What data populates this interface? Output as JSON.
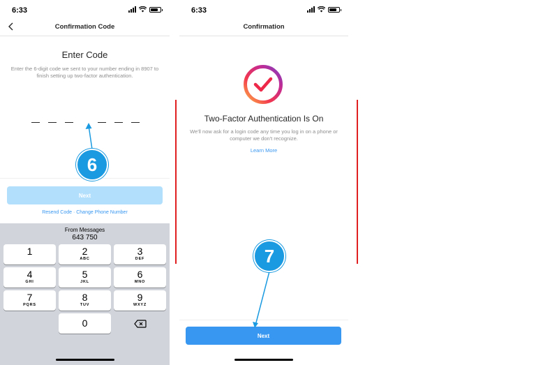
{
  "status_bar": {
    "time": "6:33"
  },
  "left_screen": {
    "nav_title": "Confirmation Code",
    "heading": "Enter Code",
    "subtext": "Enter the 6-digit code we sent to your number ending in 8907 to finish setting up two-factor authentication.",
    "next_label": "Next",
    "resend_label": "Resend Code",
    "link_separator": " · ",
    "change_phone_label": "Change Phone Number",
    "keyboard": {
      "suggestion_label": "From Messages",
      "suggestion_code": "643 750",
      "keys": [
        {
          "digit": "1",
          "letters": ""
        },
        {
          "digit": "2",
          "letters": "ABC"
        },
        {
          "digit": "3",
          "letters": "DEF"
        },
        {
          "digit": "4",
          "letters": "GHI"
        },
        {
          "digit": "5",
          "letters": "JKL"
        },
        {
          "digit": "6",
          "letters": "MNO"
        },
        {
          "digit": "7",
          "letters": "PQRS"
        },
        {
          "digit": "8",
          "letters": "TUV"
        },
        {
          "digit": "9",
          "letters": "WXYZ"
        },
        {
          "digit": "0",
          "letters": ""
        }
      ],
      "delete_icon": "backspace-icon"
    }
  },
  "right_screen": {
    "nav_title": "Confirmation",
    "heading": "Two-Factor Authentication Is On",
    "subtext": "We'll now ask for a login code any time you log in on a phone or computer we don't recognize.",
    "learn_more_label": "Learn More",
    "next_label": "Next"
  },
  "annotations": {
    "step_6": "6",
    "step_7": "7"
  },
  "colors": {
    "accent_blue": "#3897f0",
    "disabled_blue": "#b2dffc",
    "badge_blue": "#1a9ae0",
    "red_line": "#e02020",
    "keyboard_bg": "#d1d4da"
  }
}
